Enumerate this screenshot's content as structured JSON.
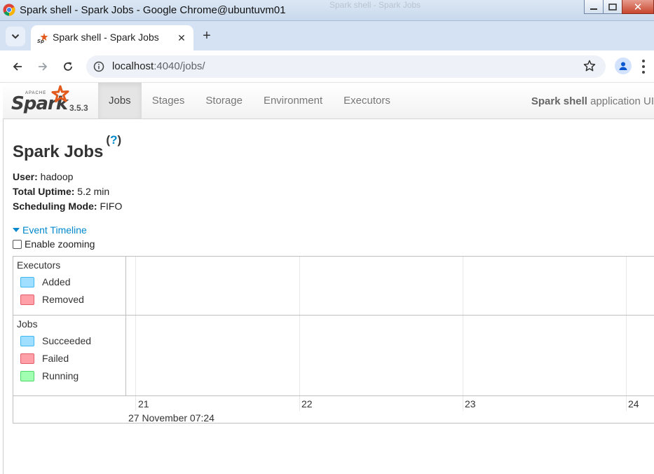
{
  "window": {
    "title": "Spark shell - Spark Jobs - Google Chrome@ubuntuvm01",
    "background_hint": "Spark shell - Spark Jobs"
  },
  "browser": {
    "tab": {
      "title": "Spark shell - Spark Jobs",
      "close": "✕"
    },
    "new_tab": "+",
    "url": {
      "host": "localhost",
      "rest": ":4040/jobs/"
    }
  },
  "spark": {
    "brand": {
      "apache": "APACHE",
      "name": "Spark",
      "version": "3.5.3"
    },
    "nav": [
      "Jobs",
      "Stages",
      "Storage",
      "Environment",
      "Executors"
    ],
    "active_nav": "Jobs",
    "app_name": "Spark shell",
    "app_suffix": " application UI"
  },
  "page": {
    "title": "Spark Jobs",
    "help": "?",
    "summary": [
      {
        "key": "User:",
        "value": " hadoop"
      },
      {
        "key": "Total Uptime:",
        "value": " 5.2 min"
      },
      {
        "key": "Scheduling Mode:",
        "value": " FIFO"
      }
    ],
    "timeline_toggle": "Event Timeline",
    "zoom_label": "Enable zooming"
  },
  "timeline": {
    "groups": [
      {
        "name": "Executors",
        "legend": [
          "Added",
          "Removed"
        ]
      },
      {
        "name": "Jobs",
        "legend": [
          "Succeeded",
          "Failed",
          "Running"
        ]
      }
    ],
    "ticks": [
      "21",
      "22",
      "23",
      "24"
    ],
    "major_label": "27 November 07:24",
    "colors": {
      "added": "#a0dfff",
      "removed": "#ff9fa8",
      "succeeded": "#a0dfff",
      "failed": "#ff9fa8",
      "running": "#a0ffb0"
    }
  }
}
